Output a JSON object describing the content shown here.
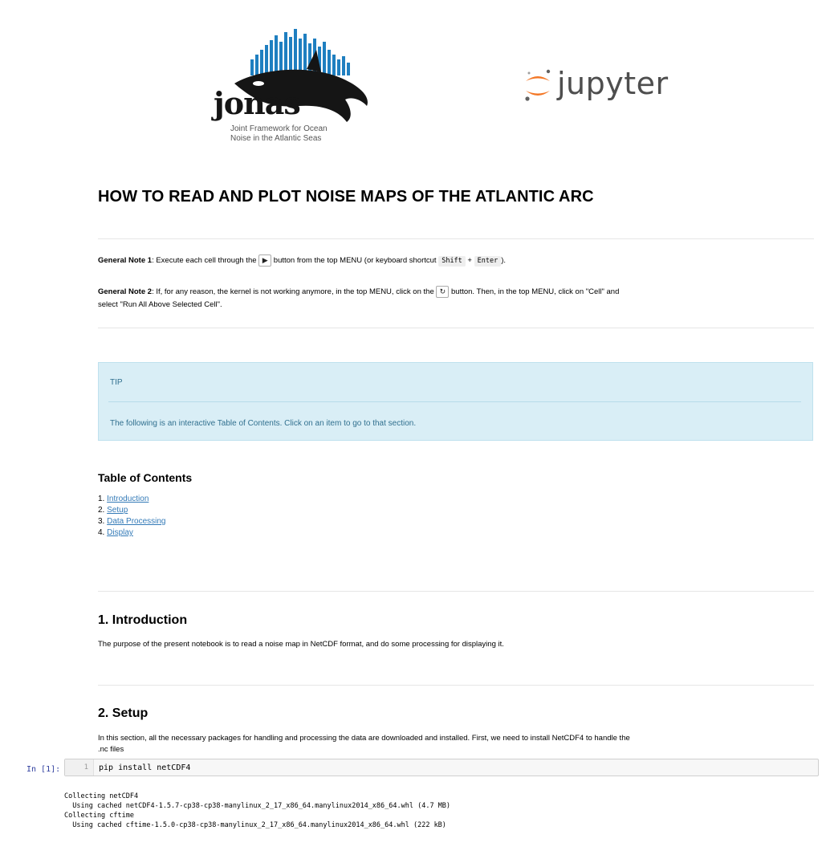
{
  "logos": {
    "jonas_word": "jonas",
    "jonas_subtitle_line1": "Joint Framework for Ocean",
    "jonas_subtitle_line2": "Noise in the Atlantic Seas",
    "jupyter_word": "jupyter"
  },
  "title": "HOW TO READ AND PLOT NOISE MAPS OF THE ATLANTIC ARC",
  "notes": {
    "note1_label": "General Note 1",
    "note1_text_a": ": Execute each cell through the ",
    "note1_text_b": " button from the top MENU (or keyboard shortcut ",
    "note1_key1": "Shift",
    "note1_plus": " + ",
    "note1_key2": "Enter",
    "note1_text_c": ").",
    "note2_label": "General Note 2",
    "note2_text_a": ": If, for any reason, the kernel is not working anymore, in the top MENU, click on the ",
    "note2_text_b": " button. Then, in the top MENU, click on \"Cell\" and",
    "note2_text_c": "select \"Run All Above Selected Cell\"."
  },
  "tip": {
    "heading": "TIP",
    "body": "The following is an interactive Table of Contents. Click on an item to go to that section."
  },
  "toc": {
    "title": "Table of Contents",
    "items": [
      {
        "num": "1. ",
        "label": "Introduction"
      },
      {
        "num": "2. ",
        "label": "Setup"
      },
      {
        "num": "3. ",
        "label": "Data Processing"
      },
      {
        "num": "4. ",
        "label": "Display"
      }
    ]
  },
  "intro": {
    "heading": "1. Introduction",
    "text": "The purpose of the present notebook is to read a noise map in NetCDF format, and do some processing for displaying it."
  },
  "setup": {
    "heading": "2. Setup",
    "text_line1": "In this section, all the necessary packages for handling and processing the data are downloaded and installed. First, we need to install NetCDF4 to handle the",
    "text_line2": ".nc files"
  },
  "cell": {
    "prompt": "In [1]:",
    "line_no": "1",
    "code": "pip install netCDF4",
    "output": [
      "Collecting netCDF4",
      "  Using cached netCDF4-1.5.7-cp38-cp38-manylinux_2_17_x86_64.manylinux2014_x86_64.whl (4.7 MB)",
      "Collecting cftime",
      "  Using cached cftime-1.5.0-cp38-cp38-manylinux_2_17_x86_64.manylinux2014_x86_64.whl (222 kB)"
    ]
  },
  "colors": {
    "link": "#337ab7",
    "tip_bg": "#d9eef6",
    "tip_text": "#31708f",
    "prompt": "#303f9f"
  }
}
